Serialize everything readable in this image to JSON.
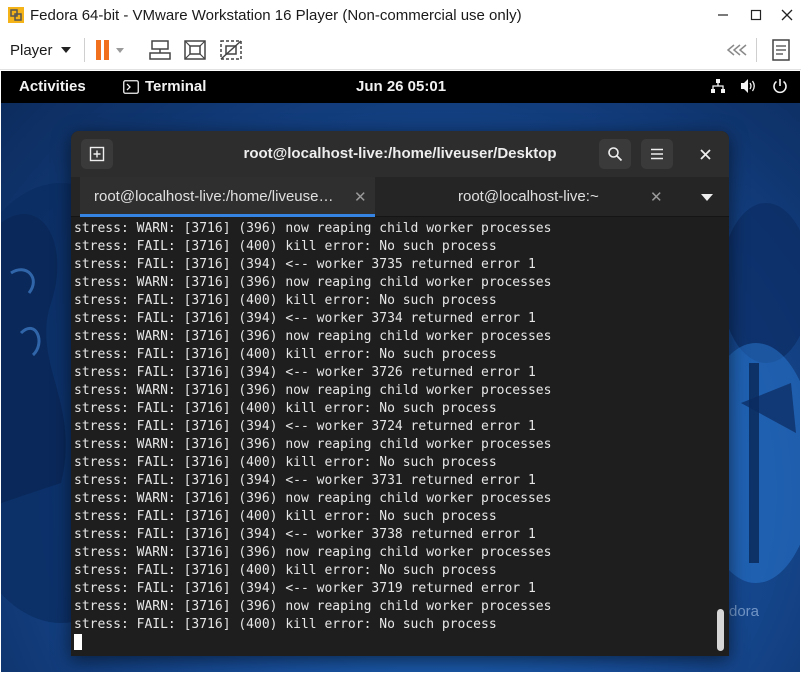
{
  "window": {
    "title": "Fedora 64-bit - VMware Workstation 16 Player (Non-commercial use only)",
    "icon": "vmware-player-icon",
    "controls": [
      "minimize-icon",
      "maximize-icon",
      "close-icon"
    ]
  },
  "toolbar": {
    "player_label": "Player",
    "icons": [
      "pause-icon",
      "send-ctrl-alt-del-icon",
      "fit-guest-icon",
      "unity-icon",
      "back-arrows-icon",
      "notes-icon"
    ]
  },
  "gnome": {
    "activities": "Activities",
    "app_name": "Terminal",
    "clock": "Jun 26  05:01",
    "tray_icons": [
      "network-icon",
      "volume-icon",
      "power-icon"
    ]
  },
  "terminal": {
    "title": "root@localhost-live:/home/liveuser/Desktop",
    "tabs": [
      {
        "label": "root@localhost-live:/home/liveuse…",
        "active": true
      },
      {
        "label": "root@localhost-live:~",
        "active": false
      }
    ],
    "lines": [
      "stress: WARN: [3716] (396) now reaping child worker processes",
      "stress: FAIL: [3716] (400) kill error: No such process",
      "stress: FAIL: [3716] (394) <-- worker 3735 returned error 1",
      "stress: WARN: [3716] (396) now reaping child worker processes",
      "stress: FAIL: [3716] (400) kill error: No such process",
      "stress: FAIL: [3716] (394) <-- worker 3734 returned error 1",
      "stress: WARN: [3716] (396) now reaping child worker processes",
      "stress: FAIL: [3716] (400) kill error: No such process",
      "stress: FAIL: [3716] (394) <-- worker 3726 returned error 1",
      "stress: WARN: [3716] (396) now reaping child worker processes",
      "stress: FAIL: [3716] (400) kill error: No such process",
      "stress: FAIL: [3716] (394) <-- worker 3724 returned error 1",
      "stress: WARN: [3716] (396) now reaping child worker processes",
      "stress: FAIL: [3716] (400) kill error: No such process",
      "stress: FAIL: [3716] (394) <-- worker 3731 returned error 1",
      "stress: WARN: [3716] (396) now reaping child worker processes",
      "stress: FAIL: [3716] (400) kill error: No such process",
      "stress: FAIL: [3716] (394) <-- worker 3738 returned error 1",
      "stress: WARN: [3716] (396) now reaping child worker processes",
      "stress: FAIL: [3716] (400) kill error: No such process",
      "stress: FAIL: [3716] (394) <-- worker 3719 returned error 1",
      "stress: WARN: [3716] (396) now reaping child worker processes",
      "stress: FAIL: [3716] (400) kill error: No such process"
    ],
    "scroll_position": 0.97
  },
  "wallpaper": {
    "watermark_text": "dora"
  },
  "colors": {
    "accent": "#3584e4",
    "terminal_bg": "#1e1e1e",
    "header_bg": "#2d2d2d",
    "pause_orange": "#f0701e"
  }
}
